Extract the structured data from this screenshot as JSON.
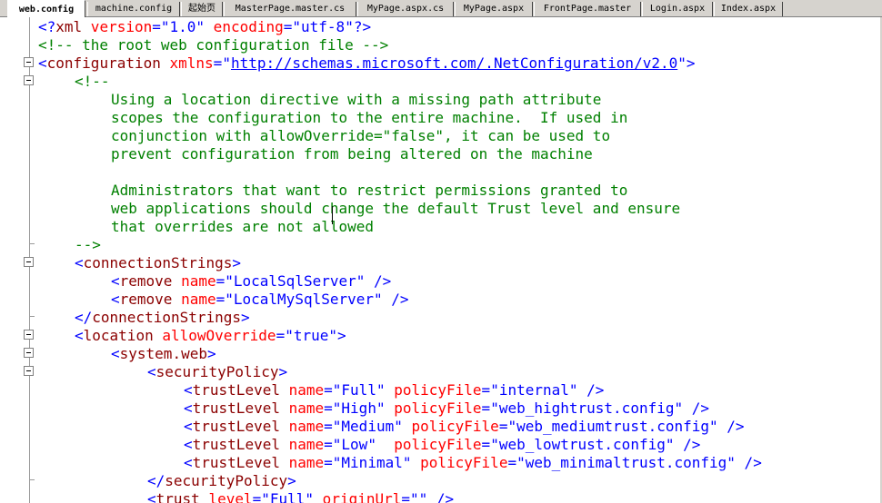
{
  "tabs": [
    {
      "label": "web.config",
      "active": true
    },
    {
      "label": "machine.config",
      "active": false
    },
    {
      "label": "起始页",
      "active": false
    },
    {
      "label": "MasterPage.master.cs",
      "active": false
    },
    {
      "label": "MyPage.aspx.cs",
      "active": false
    },
    {
      "label": "MyPage.aspx",
      "active": false
    },
    {
      "label": "FrontPage.master",
      "active": false
    },
    {
      "label": "Login.aspx",
      "active": false
    },
    {
      "label": "Index.aspx",
      "active": false
    }
  ],
  "code": {
    "l1": {
      "open": "<?",
      "name": "xml",
      "a1": " version",
      "eq1": "=",
      "v1": "\"1.0\"",
      "a2": " encoding",
      "eq2": "=",
      "v2": "\"utf-8\"",
      "close": "?>"
    },
    "l2": {
      "text": "<!-- the root web configuration file -->"
    },
    "l3": {
      "open": "<",
      "name": "configuration",
      "attr": " xmlns",
      "eq": "=",
      "q1": "\"",
      "url": "http://schemas.microsoft.com/.NetConfiguration/v2.0",
      "q2": "\"",
      "close": ">"
    },
    "l4": {
      "text": "<!--"
    },
    "l5": {
      "text": "Using a location directive with a missing path attribute"
    },
    "l6": {
      "text": "scopes the configuration to the entire machine.  If used in"
    },
    "l7": {
      "text": "conjunction with allowOverride=\"false\", it can be used to"
    },
    "l8": {
      "text": "prevent configuration from being altered on the machine"
    },
    "l10": {
      "text": "Administrators that want to restrict permissions granted to"
    },
    "l11": {
      "text": "web applications should change the default Trust level and ensure"
    },
    "l12": {
      "text": "that overrides are not allowed"
    },
    "l13": {
      "text": "-->"
    },
    "l14": {
      "open": "<",
      "name": "connectionStrings",
      "close": ">"
    },
    "l15": {
      "open": "<",
      "name": "remove",
      "attr": " name",
      "eq": "=",
      "val": "\"LocalSqlServer\"",
      "close": " />"
    },
    "l16": {
      "open": "<",
      "name": "remove",
      "attr": " name",
      "eq": "=",
      "val": "\"LocalMySqlServer\"",
      "close": " />"
    },
    "l17": {
      "open": "</",
      "name": "connectionStrings",
      "close": ">"
    },
    "l18": {
      "open": "<",
      "name": "location",
      "attr": " allowOverride",
      "eq": "=",
      "val": "\"true\"",
      "close": ">"
    },
    "l19": {
      "open": "<",
      "name": "system.web",
      "close": ">"
    },
    "l20": {
      "open": "<",
      "name": "securityPolicy",
      "close": ">"
    },
    "l21": {
      "open": "<",
      "name": "trustLevel",
      "a1": " name",
      "eq1": "=",
      "v1": "\"Full\"",
      "a2": " policyFile",
      "eq2": "=",
      "v2": "\"internal\"",
      "close": " />"
    },
    "l22": {
      "open": "<",
      "name": "trustLevel",
      "a1": " name",
      "eq1": "=",
      "v1": "\"High\"",
      "a2": " policyFile",
      "eq2": "=",
      "v2": "\"web_hightrust.config\"",
      "close": " />"
    },
    "l23": {
      "open": "<",
      "name": "trustLevel",
      "a1": " name",
      "eq1": "=",
      "v1": "\"Medium\"",
      "a2": " policyFile",
      "eq2": "=",
      "v2": "\"web_mediumtrust.config\"",
      "close": " />"
    },
    "l24": {
      "open": "<",
      "name": "trustLevel",
      "a1": " name",
      "eq1": "=",
      "v1": "\"Low\"",
      "a2": "  policyFile",
      "eq2": "=",
      "v2": "\"web_lowtrust.config\"",
      "close": " />"
    },
    "l25": {
      "open": "<",
      "name": "trustLevel",
      "a1": " name",
      "eq1": "=",
      "v1": "\"Minimal\"",
      "a2": " policyFile",
      "eq2": "=",
      "v2": "\"web_minimaltrust.config\"",
      "close": " />"
    },
    "l26": {
      "open": "</",
      "name": "securityPolicy",
      "close": ">"
    },
    "l27": {
      "open": "<",
      "name": "trust",
      "a1": " level",
      "eq1": "=",
      "v1": "\"Full\"",
      "a2": " originUrl",
      "eq2": "=",
      "v2": "\"\"",
      "close": " />"
    }
  }
}
